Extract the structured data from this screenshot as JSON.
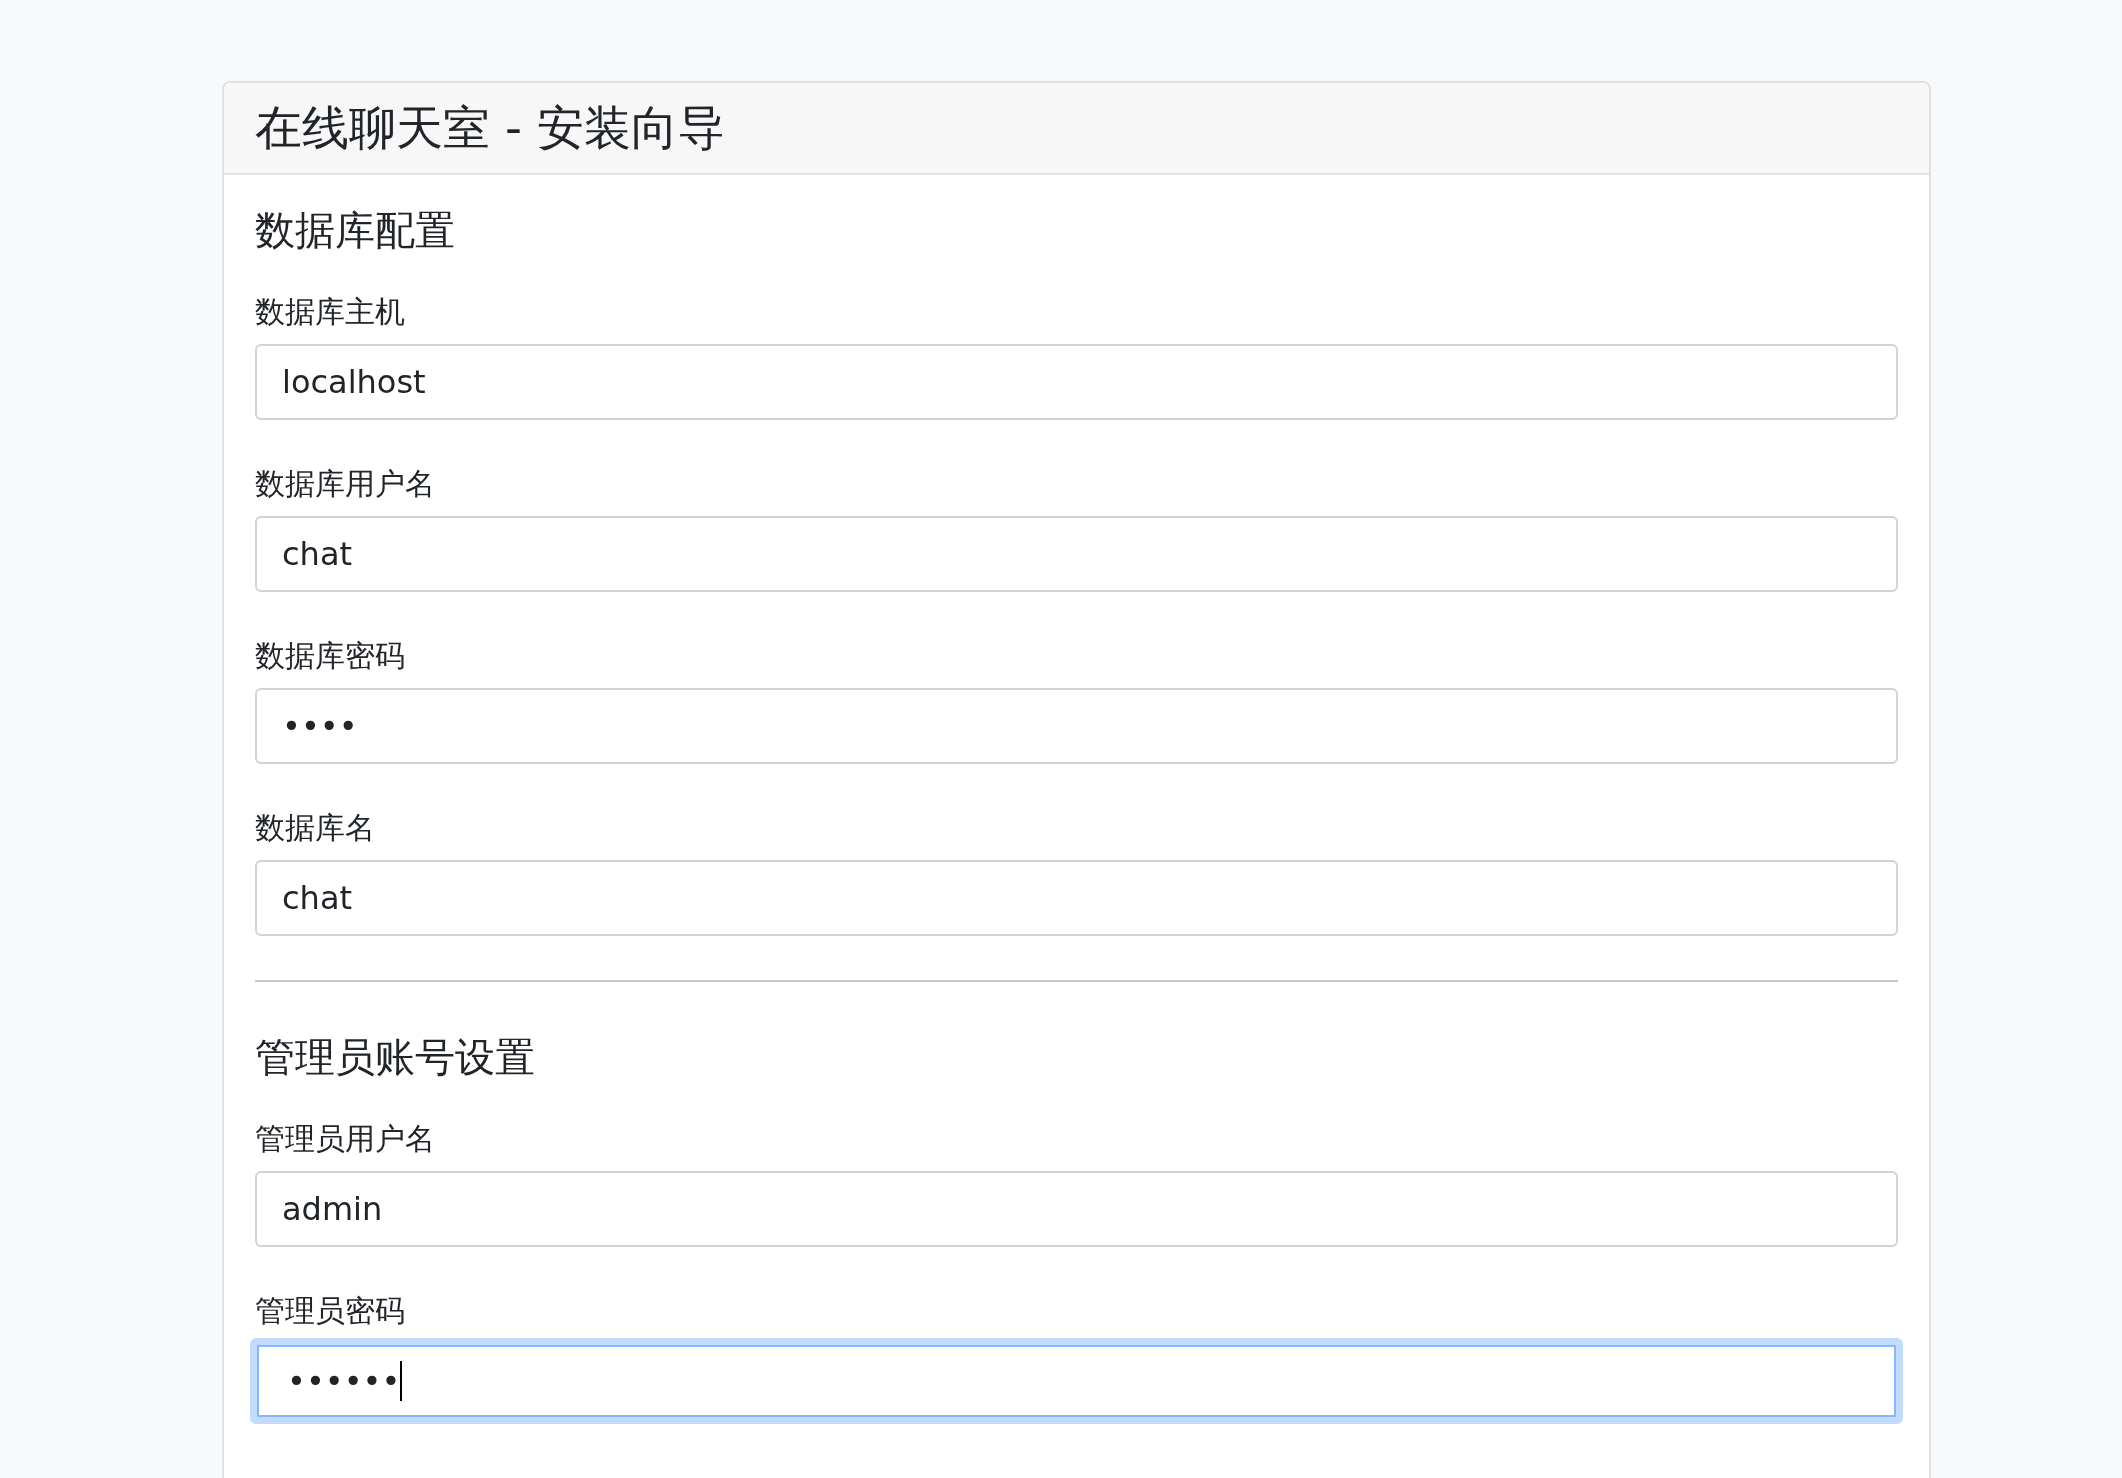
{
  "card": {
    "title": "在线聊天室 - 安装向导"
  },
  "sections": [
    {
      "heading": "数据库配置",
      "fields": [
        {
          "label": "数据库主机",
          "value": "localhost",
          "focused": false
        },
        {
          "label": "数据库用户名",
          "value": "chat",
          "focused": false
        },
        {
          "label": "数据库密码",
          "value": "••••",
          "focused": false
        },
        {
          "label": "数据库名",
          "value": "chat",
          "focused": false
        }
      ]
    },
    {
      "heading": "管理员账号设置",
      "fields": [
        {
          "label": "管理员用户名",
          "value": "admin",
          "focused": false
        },
        {
          "label": "管理员密码",
          "value": "••••••",
          "focused": true
        }
      ]
    }
  ]
}
